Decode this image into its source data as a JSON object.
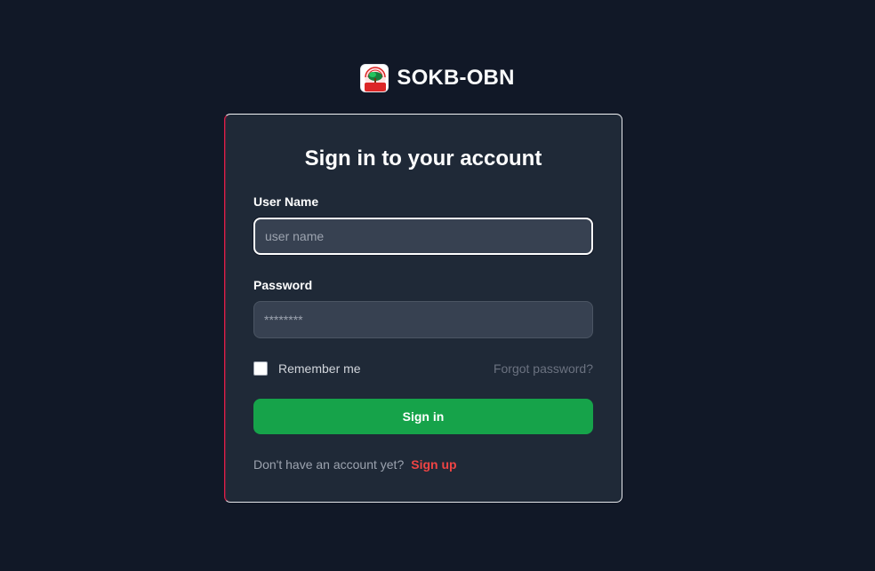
{
  "brand": {
    "name": "SOKB-OBN",
    "logo_text": "OBN",
    "logo_icon": "tree-logo-icon"
  },
  "form": {
    "title": "Sign in to your account",
    "username_label": "User Name",
    "username_placeholder": "user name",
    "username_value": "",
    "password_label": "Password",
    "password_placeholder": "********",
    "password_value": "",
    "remember_label": "Remember me",
    "remember_checked": false,
    "forgot_label": "Forgot password?",
    "submit_label": "Sign in",
    "signup_prompt": "Don't have an account yet?",
    "signup_label": "Sign up"
  },
  "colors": {
    "background": "#111827",
    "card": "#1f2937",
    "input": "#374151",
    "primary_button": "#16a34a",
    "signup_link": "#ef4444"
  }
}
